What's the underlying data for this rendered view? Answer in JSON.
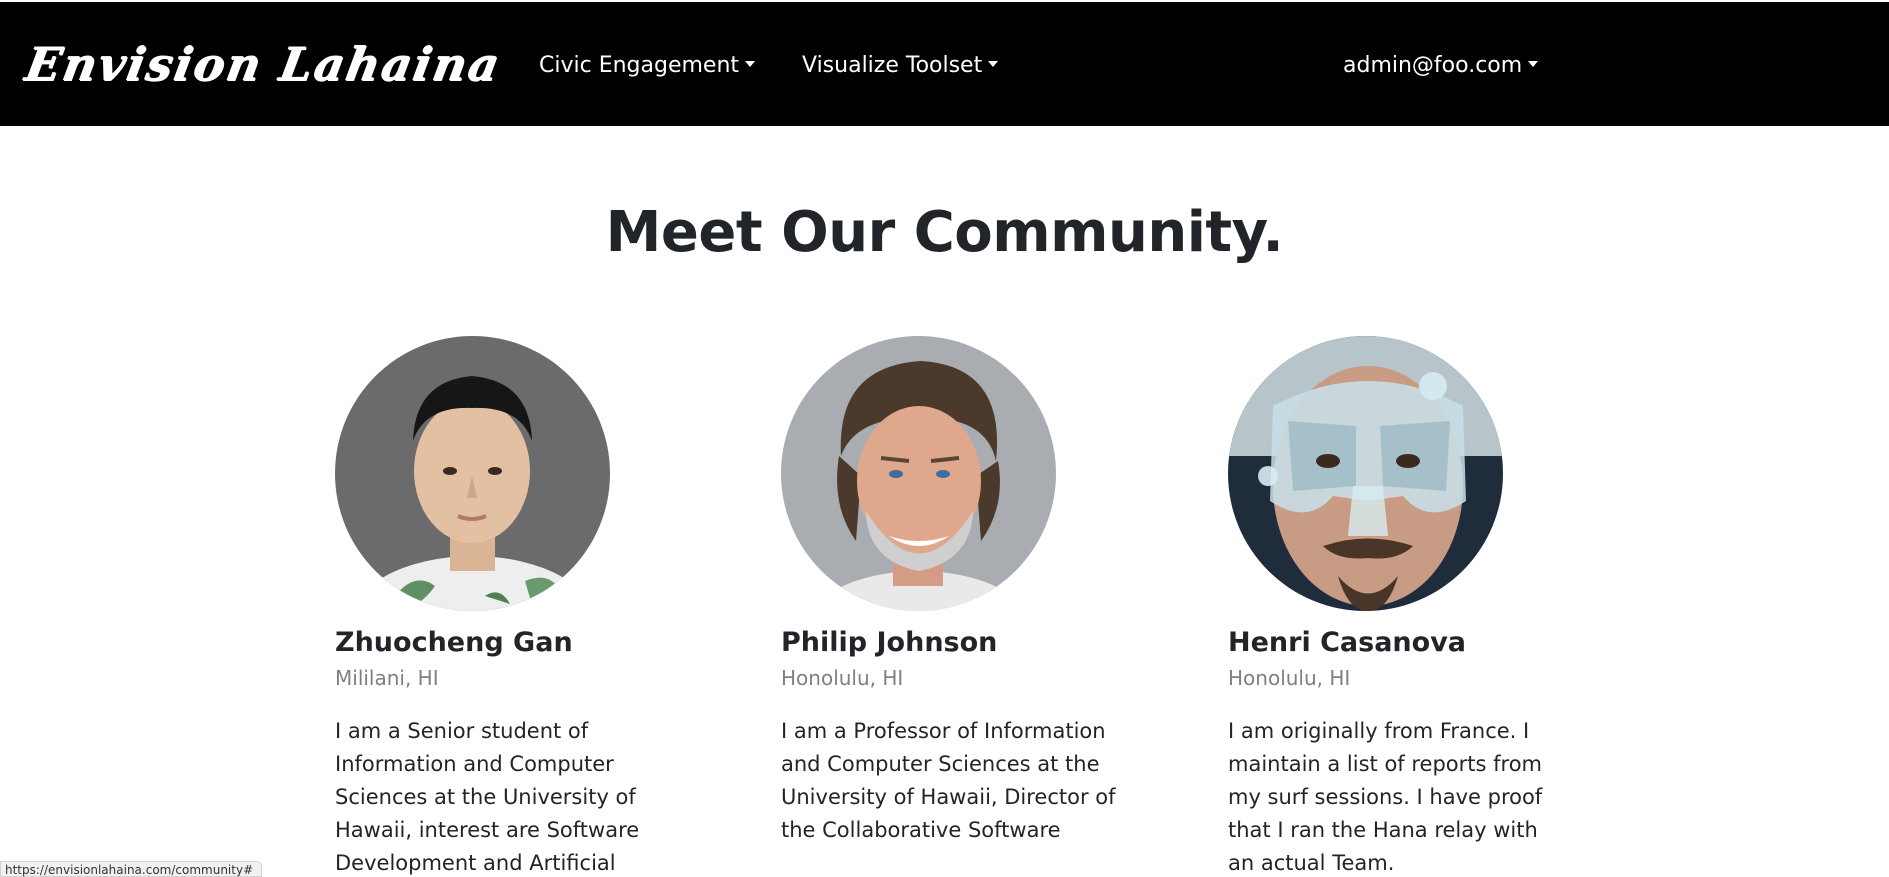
{
  "navbar": {
    "brand": "Envision Lahaina",
    "items": [
      {
        "label": "Civic Engagement"
      },
      {
        "label": "Visualize Toolset"
      }
    ],
    "user": {
      "label": "admin@foo.com"
    }
  },
  "main": {
    "title": "Meet Our Community.",
    "members": [
      {
        "name": "Zhuocheng Gan",
        "location": "Mililani, HI",
        "bio": "I am a Senior student of Information and Computer Sciences at the University of Hawaii, interest are Software Development and Artificial"
      },
      {
        "name": "Philip Johnson",
        "location": "Honolulu, HI",
        "bio": "I am a Professor of Information and Computer Sciences at the University of Hawaii, Director of the Collaborative Software"
      },
      {
        "name": "Henri Casanova",
        "location": "Honolulu, HI",
        "bio": "I am originally from France. I maintain a list of reports from my surf sessions. I have proof that I ran the Hana relay with an actual Team."
      }
    ]
  },
  "status_bar": {
    "url": "https://envisionlahaina.com/community#"
  }
}
